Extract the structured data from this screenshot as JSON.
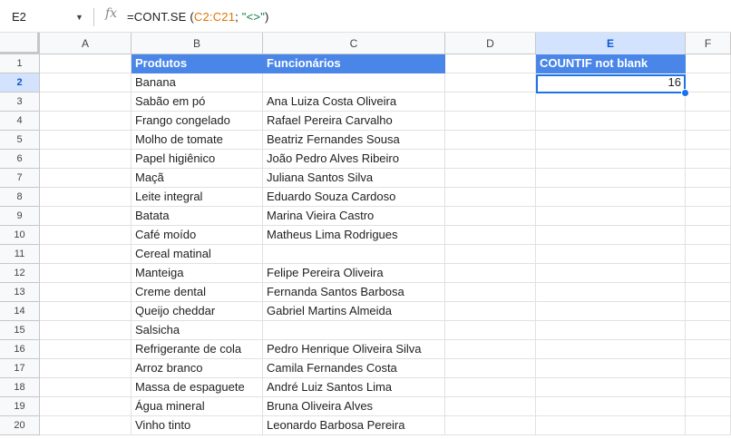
{
  "name_box": "E2",
  "formula": {
    "fn": "=CONT.SE",
    "open": " (",
    "range": "C2:C21",
    "sep": "; ",
    "str": "\"<>\"",
    "close": ")"
  },
  "columns": [
    "A",
    "B",
    "C",
    "D",
    "E",
    "F"
  ],
  "selected_column": "E",
  "selected_row": 2,
  "header_row": {
    "b": "Produtos",
    "c": "Funcionários",
    "e": "COUNTIF not blank"
  },
  "result_value": "16",
  "rows": [
    {
      "num": "1"
    },
    {
      "num": "2",
      "b": "Banana",
      "c": ""
    },
    {
      "num": "3",
      "b": "Sabão em pó",
      "c": "Ana Luiza Costa Oliveira"
    },
    {
      "num": "4",
      "b": "Frango congelado",
      "c": "Rafael Pereira Carvalho"
    },
    {
      "num": "5",
      "b": "Molho de tomate",
      "c": "Beatriz Fernandes Sousa"
    },
    {
      "num": "6",
      "b": "Papel higiênico",
      "c": "João Pedro Alves Ribeiro"
    },
    {
      "num": "7",
      "b": "Maçã",
      "c": "Juliana Santos Silva"
    },
    {
      "num": "8",
      "b": "Leite integral",
      "c": "Eduardo Souza Cardoso"
    },
    {
      "num": "9",
      "b": "Batata",
      "c": "Marina Vieira Castro"
    },
    {
      "num": "10",
      "b": "Café moído",
      "c": "Matheus Lima Rodrigues"
    },
    {
      "num": "11",
      "b": "Cereal matinal",
      "c": ""
    },
    {
      "num": "12",
      "b": "Manteiga",
      "c": "Felipe Pereira Oliveira"
    },
    {
      "num": "13",
      "b": "Creme dental",
      "c": "Fernanda Santos Barbosa"
    },
    {
      "num": "14",
      "b": "Queijo cheddar",
      "c": "Gabriel Martins Almeida"
    },
    {
      "num": "15",
      "b": "Salsicha",
      "c": ""
    },
    {
      "num": "16",
      "b": "Refrigerante de cola",
      "c": "Pedro Henrique Oliveira Silva"
    },
    {
      "num": "17",
      "b": "Arroz branco",
      "c": "Camila Fernandes Costa"
    },
    {
      "num": "18",
      "b": "Massa de espaguete",
      "c": "André Luiz Santos Lima"
    },
    {
      "num": "19",
      "b": "Água mineral",
      "c": "Bruna Oliveira Alves"
    },
    {
      "num": "20",
      "b": "Vinho tinto",
      "c": "Leonardo Barbosa Pereira"
    }
  ]
}
